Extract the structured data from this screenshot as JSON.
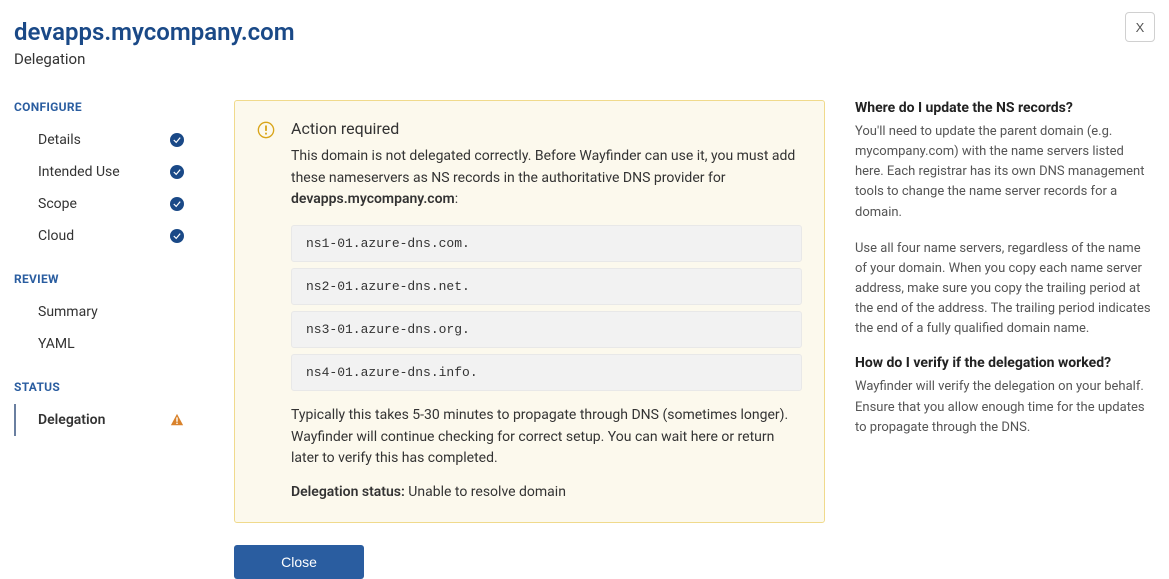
{
  "header": {
    "title": "devapps.mycompany.com",
    "subtitle": "Delegation"
  },
  "close_x": "X",
  "sidebar": {
    "configure_label": "CONFIGURE",
    "configure_items": [
      {
        "label": "Details",
        "checked": true
      },
      {
        "label": "Intended Use",
        "checked": true
      },
      {
        "label": "Scope",
        "checked": true
      },
      {
        "label": "Cloud",
        "checked": true
      }
    ],
    "review_label": "REVIEW",
    "review_items": [
      {
        "label": "Summary"
      },
      {
        "label": "YAML"
      }
    ],
    "status_label": "STATUS",
    "status_items": [
      {
        "label": "Delegation",
        "warning": true,
        "active": true
      }
    ]
  },
  "alert": {
    "title": "Action required",
    "text_before": "This domain is not delegated correctly. Before Wayfinder can use it, you must add these nameservers as NS records in the authoritative DNS provider for ",
    "text_bold": "devapps.mycompany.com",
    "text_after": ":",
    "nameservers": [
      "ns1-01.azure-dns.com.",
      "ns2-01.azure-dns.net.",
      "ns3-01.azure-dns.org.",
      "ns4-01.azure-dns.info."
    ],
    "propagation_text": "Typically this takes 5-30 minutes to propagate through DNS (sometimes longer). Wayfinder will continue checking for correct setup. You can wait here or return later to verify this has completed.",
    "status_label": "Delegation status:",
    "status_value": " Unable to resolve domain"
  },
  "close_button": "Close",
  "help": {
    "q1_title": "Where do I update the NS records?",
    "q1_p1": "You'll need to update the parent domain (e.g. mycompany.com) with the name servers listed here. Each registrar has its own DNS management tools to change the name server records for a domain.",
    "q1_p2": "Use all four name servers, regardless of the name of your domain. When you copy each name server address, make sure you copy the trailing period at the end of the address. The trailing period indicates the end of a fully qualified domain name.",
    "q2_title": "How do I verify if the delegation worked?",
    "q2_p1": "Wayfinder will verify the delegation on your behalf. Ensure that you allow enough time for the updates to propagate through the DNS."
  }
}
